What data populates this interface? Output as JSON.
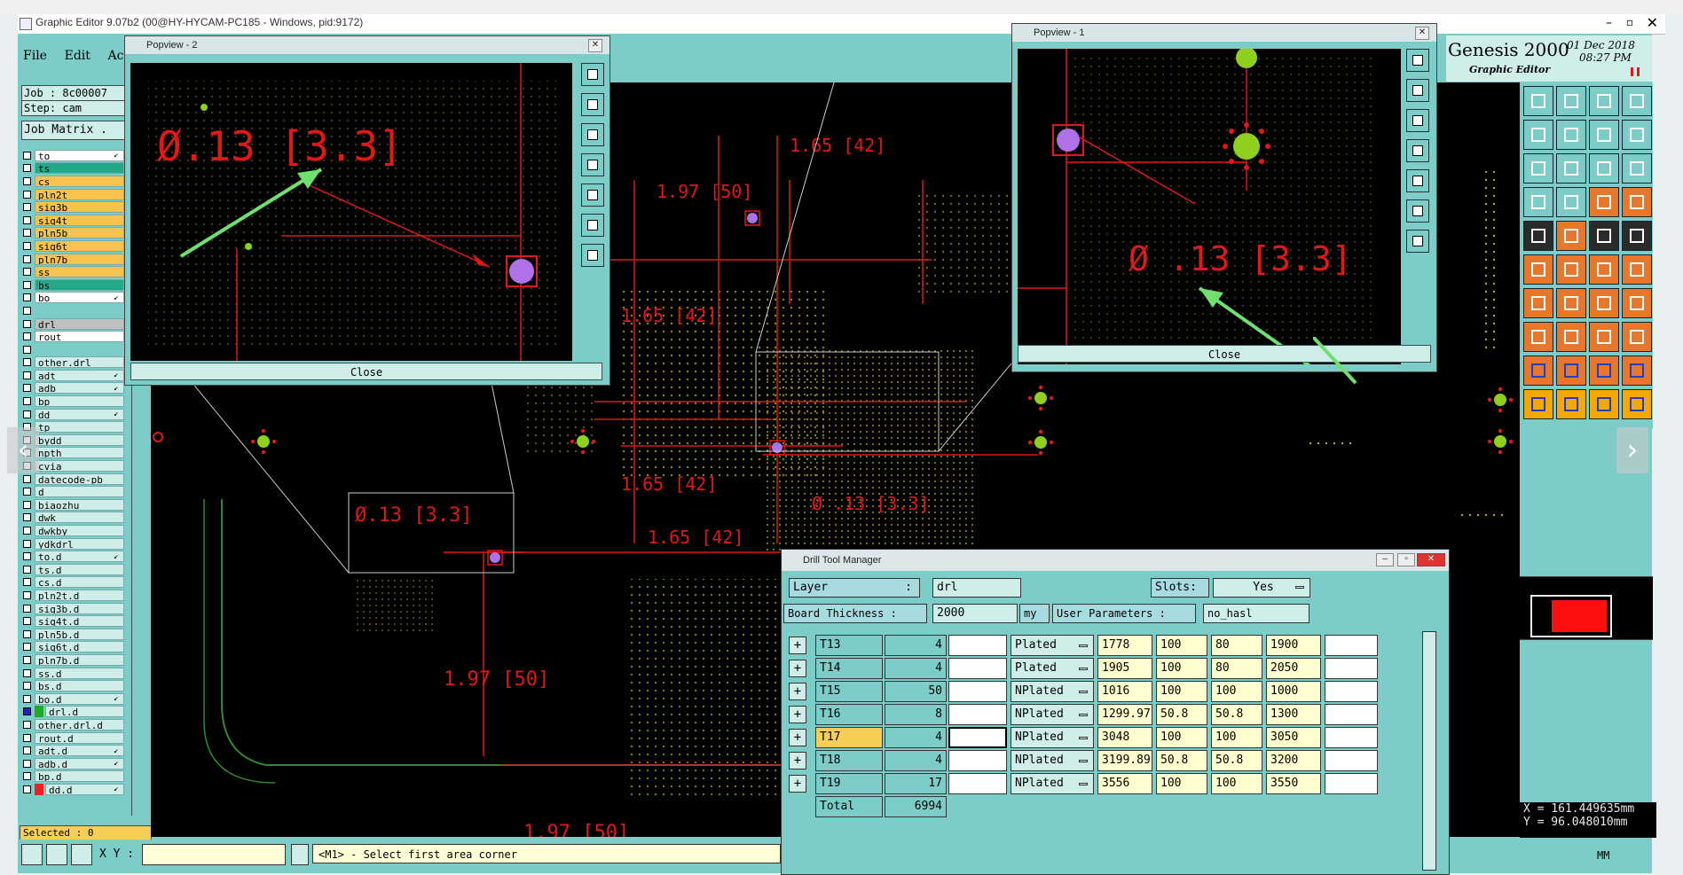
{
  "window": {
    "title": "Graphic Editor 9.07b2 (00@HY-HYCAM-PC185 - Windows, pid:9172)"
  },
  "menu": [
    "File",
    "Edit",
    "Act"
  ],
  "job": {
    "label": "Job : 8c00007",
    "step": "Step: cam",
    "matrix": "Job Matrix ."
  },
  "layers": [
    {
      "name": "to",
      "color": "#ffffff",
      "arrow": true
    },
    {
      "name": "ts",
      "color": "#22aa88"
    },
    {
      "name": "cs",
      "color": "#f7c24e"
    },
    {
      "name": "pln2t",
      "color": "#f7c24e"
    },
    {
      "name": "sig3b",
      "color": "#f7c24e"
    },
    {
      "name": "sig4t",
      "color": "#f7c24e"
    },
    {
      "name": "pln5b",
      "color": "#f7c24e"
    },
    {
      "name": "sig6t",
      "color": "#f7c24e"
    },
    {
      "name": "pln7b",
      "color": "#f7c24e"
    },
    {
      "name": "ss",
      "color": "#f7c24e"
    },
    {
      "name": "bs",
      "color": "#22aa88"
    },
    {
      "name": "bo",
      "color": "#ffffff",
      "arrow": true
    },
    {
      "name": "",
      "color": "#7ccdc7"
    },
    {
      "name": "drl",
      "color": "#c0c0c0"
    },
    {
      "name": "rout",
      "color": "#ffffff"
    },
    {
      "name": "",
      "color": "#7ccdc7"
    },
    {
      "name": "other.drl",
      "color": "#cfeee9"
    },
    {
      "name": "adt",
      "color": "#cfeee9",
      "arrow": true
    },
    {
      "name": "adb",
      "color": "#cfeee9",
      "arrow": true
    },
    {
      "name": "bp",
      "color": "#cfeee9"
    },
    {
      "name": "dd",
      "color": "#cfeee9",
      "arrow": true
    },
    {
      "name": "tp",
      "color": "#cfeee9"
    },
    {
      "name": "bydd",
      "color": "#cfeee9"
    },
    {
      "name": "npth",
      "color": "#cfeee9"
    },
    {
      "name": "cvia",
      "color": "#cfeee9"
    },
    {
      "name": "datecode-pb",
      "color": "#cfeee9"
    },
    {
      "name": "d",
      "color": "#cfeee9"
    },
    {
      "name": "biaozhu",
      "color": "#cfeee9"
    },
    {
      "name": "dwk",
      "color": "#cfeee9"
    },
    {
      "name": "dwkby",
      "color": "#cfeee9"
    },
    {
      "name": "ydkdrl",
      "color": "#cfeee9"
    },
    {
      "name": "to.d",
      "color": "#cfeee9",
      "arrow": true
    },
    {
      "name": "ts.d",
      "color": "#cfeee9"
    },
    {
      "name": "cs.d",
      "color": "#cfeee9"
    },
    {
      "name": "pln2t.d",
      "color": "#cfeee9"
    },
    {
      "name": "sig3b.d",
      "color": "#cfeee9"
    },
    {
      "name": "sig4t.d",
      "color": "#cfeee9"
    },
    {
      "name": "pln5b.d",
      "color": "#cfeee9"
    },
    {
      "name": "sig6t.d",
      "color": "#cfeee9"
    },
    {
      "name": "pln7b.d",
      "color": "#cfeee9"
    },
    {
      "name": "ss.d",
      "color": "#cfeee9"
    },
    {
      "name": "bs.d",
      "color": "#cfeee9"
    },
    {
      "name": "bo.d",
      "color": "#cfeee9",
      "arrow": true
    },
    {
      "name": "drl.d",
      "color": "#cfeee9",
      "swatch": "#22aa22",
      "active": true
    },
    {
      "name": "other.drl.d",
      "color": "#cfeee9"
    },
    {
      "name": "rout.d",
      "color": "#cfeee9"
    },
    {
      "name": "adt.d",
      "color": "#cfeee9",
      "arrow": true
    },
    {
      "name": "adb.d",
      "color": "#cfeee9",
      "arrow": true
    },
    {
      "name": "bp.d",
      "color": "#cfeee9"
    },
    {
      "name": "dd.d",
      "color": "#cfeee9",
      "swatch": "#ee2222",
      "arrow": true
    }
  ],
  "selected": "Selected : 0",
  "genesis": {
    "name": "Genesis 2000",
    "date": "01 Dec 2018",
    "time": "08:27 PM",
    "sub": "Graphic Editor"
  },
  "popview2": {
    "title": "Popview - 2",
    "close": "Close",
    "callout": "Ø.13 [3.3]"
  },
  "popview1": {
    "title": "Popview - 1",
    "close": "Close",
    "callout": "Ø .13 [3.3]"
  },
  "canvas_labels": {
    "a": "1.65 [42]",
    "b": "1.97 [50]",
    "c": "1.97 [50]",
    "d": "Ø.13 [3.3]",
    "e": "Ø .13 [3.3]",
    "f": "1.65 [42]",
    "g": "1.65 [42]",
    "h": "1.97 [50]",
    "i": "1.65 [42]"
  },
  "coords": {
    "x": "X = 161.449635mm",
    "y": "Y = 96.048010mm"
  },
  "status": {
    "xy_label": "X Y :",
    "message": "<M1> - Select first area corner",
    "units": "MM"
  },
  "drill_manager": {
    "title": "Drill Tool Manager",
    "layer_label": "Layer",
    "layer_colon": ":",
    "layer_value": "drl",
    "slots_label": "Slots:",
    "slots_value": "Yes",
    "board_label": "Board Thickness :",
    "board_value": "2000",
    "board_unit": "my",
    "user_label": "User Parameters :",
    "user_value": "no_hasl",
    "rows": [
      {
        "tool": "T13",
        "count": "4",
        "type": "Plated",
        "v1": "1778",
        "v2": "100",
        "v3": "80",
        "v4": "1900"
      },
      {
        "tool": "T14",
        "count": "4",
        "type": "Plated",
        "v1": "1905",
        "v2": "100",
        "v3": "80",
        "v4": "2050"
      },
      {
        "tool": "T15",
        "count": "50",
        "type": "NPlated",
        "v1": "1016",
        "v2": "100",
        "v3": "100",
        "v4": "1000"
      },
      {
        "tool": "T16",
        "count": "8",
        "type": "NPlated",
        "v1": "1299.97",
        "v2": "50.8",
        "v3": "50.8",
        "v4": "1300"
      },
      {
        "tool": "T17",
        "count": "4",
        "type": "NPlated",
        "v1": "3048",
        "v2": "100",
        "v3": "100",
        "v4": "3050",
        "selected": true
      },
      {
        "tool": "T18",
        "count": "4",
        "type": "NPlated",
        "v1": "3199.89",
        "v2": "50.8",
        "v3": "50.8",
        "v4": "3200"
      },
      {
        "tool": "T19",
        "count": "17",
        "type": "NPlated",
        "v1": "3556",
        "v2": "100",
        "v3": "100",
        "v4": "3550"
      }
    ],
    "total_label": "Total",
    "total_value": "6994"
  }
}
